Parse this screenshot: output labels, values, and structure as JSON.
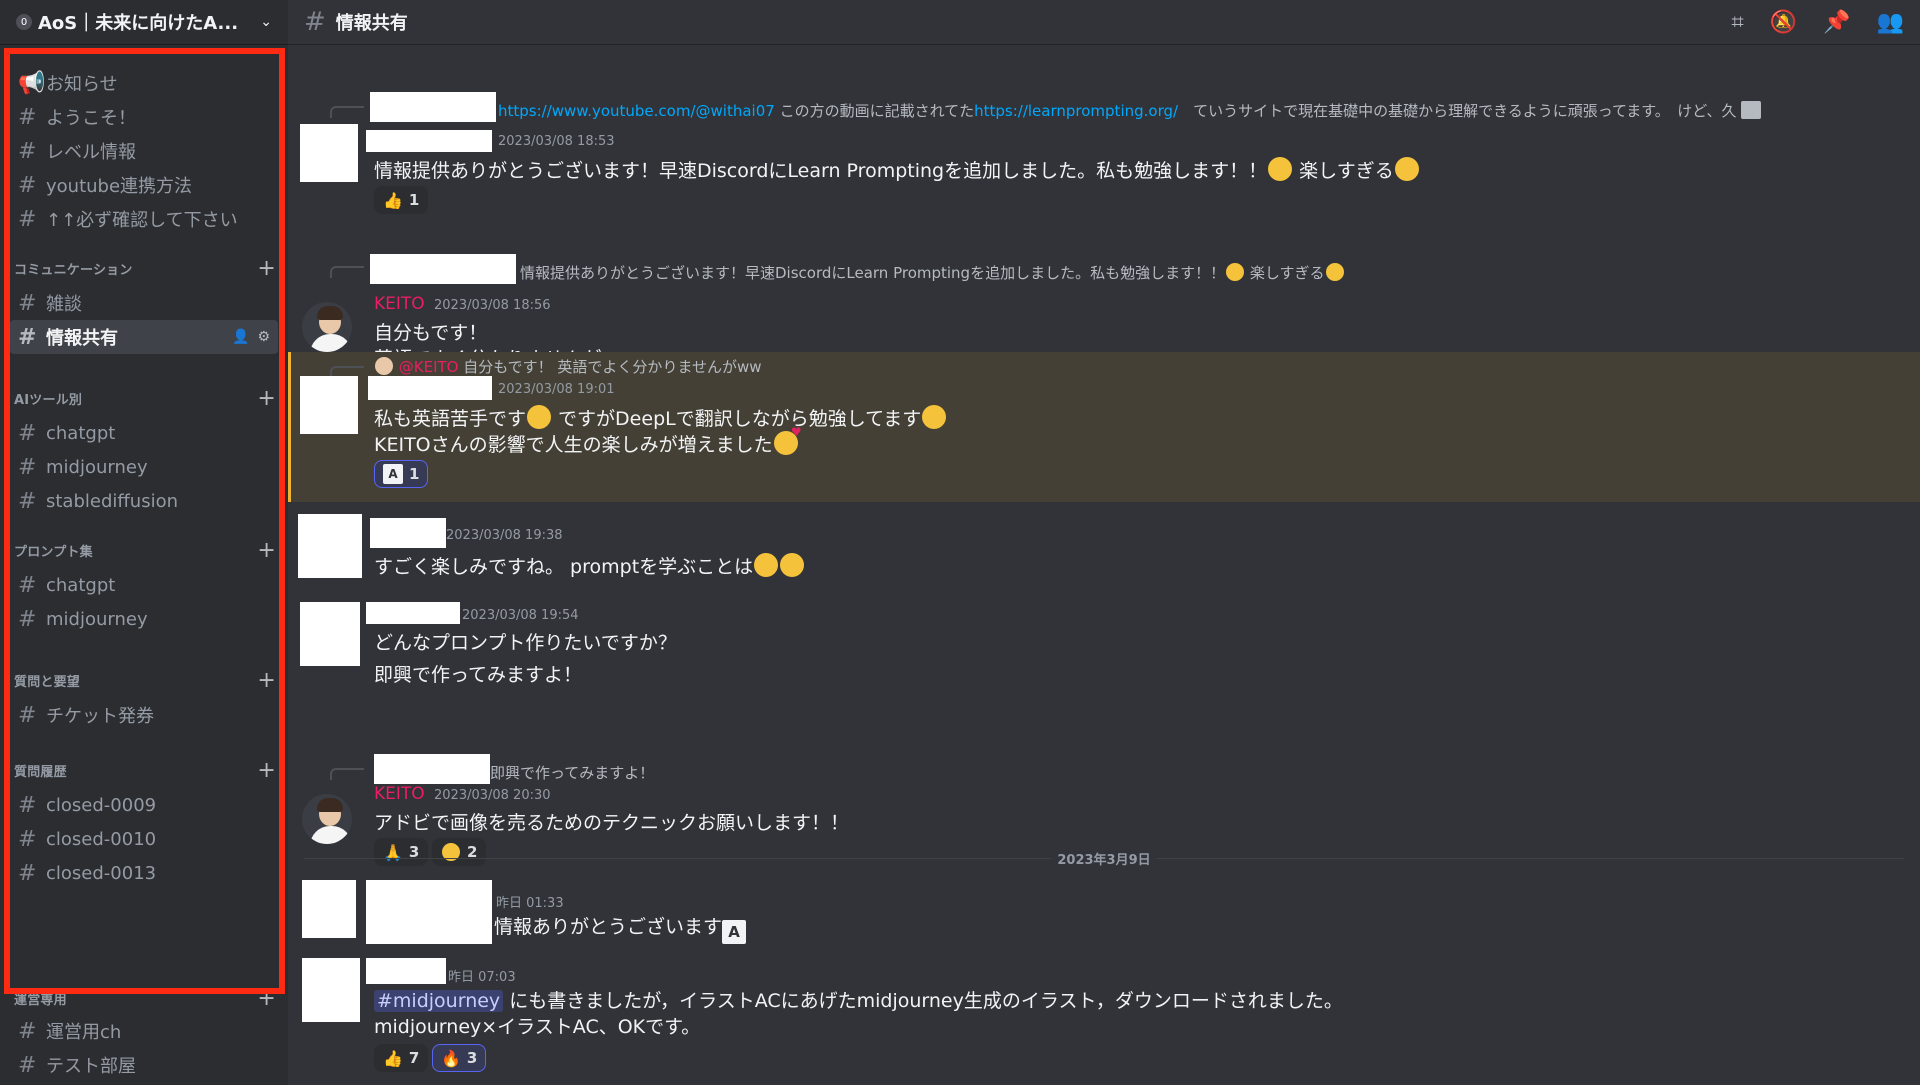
{
  "server": {
    "badge": "0",
    "name": "AoS｜未来に向けたA..."
  },
  "sidebar": {
    "channels_top": [
      {
        "label": "お知らせ",
        "icon": "megaphone-icon"
      },
      {
        "label": "ようこそ！",
        "icon": "hash-icon"
      },
      {
        "label": "レベル情報",
        "icon": "hash-icon"
      },
      {
        "label": "youtube連携方法",
        "icon": "hash-icon"
      },
      {
        "label": "↑↑必ず確認して下さい",
        "icon": "hash-icon"
      }
    ],
    "categories": {
      "communication": "コミュニケーション",
      "ai_tools": "AIツール別",
      "prompts": "プロンプト集",
      "questions": "質問と要望",
      "history": "質問履歴",
      "admin": "運営専用"
    },
    "communication": [
      "雑談",
      "情報共有"
    ],
    "ai_tools": [
      "chatgpt",
      "midjourney",
      "stablediffusion"
    ],
    "prompts": [
      "chatgpt",
      "midjourney"
    ],
    "questions": [
      "チケット発券"
    ],
    "history": [
      "closed-0009",
      "closed-0010",
      "closed-0013"
    ],
    "admin": [
      "運営用ch",
      "テスト部屋"
    ],
    "highlight_color": "#ff2a12"
  },
  "topbar": {
    "channel": "情報共有"
  },
  "messages": {
    "m1": {
      "reply_link1": "https://www.youtube.com/@withai07",
      "reply_mid": " この方の動画に記載されてた",
      "reply_link2": "https://learnprompting.org/",
      "reply_tail": "　ていうサイトで現在基礎中の基礎から理解できるように頑張ってます。　けど、久",
      "time": "2023/03/08 18:53",
      "text": "情報提供ありがとうございます！早速DiscordにLearn Promptingを追加しました。私も勉強します！！",
      "text_tail": " 楽しすぎる",
      "reaction_count": "1"
    },
    "m2": {
      "reply": "情報提供ありがとうございます！早速DiscordにLearn Promptingを追加しました。私も勉強します！！",
      "reply_tail": " 楽しすぎる",
      "author": "KEITO",
      "time": "2023/03/08 18:56",
      "line1": "自分もです！",
      "line2": "英語でよく分かりませんがww"
    },
    "m3": {
      "reply_author": "@KEITO",
      "reply": " 自分もです！ 英語でよく分かりませんがww",
      "time": "2023/03/08 19:01",
      "line1a": "私も英語苦手です",
      "line1b": " ですがDeepLで翻訳しながら勉強してます",
      "line2": "KEITOさんの影響で人生の楽しみが増えました",
      "reaction_icon": "A",
      "reaction_count": "1"
    },
    "m4": {
      "time": "2023/03/08 19:38",
      "text": "すごく楽しみですね。 promptを学ぶことは"
    },
    "m5": {
      "time": "2023/03/08 19:54",
      "line1": "どんなプロンプト作りたいですか？",
      "line2": "即興で作ってみますよ！"
    },
    "m6": {
      "reply": "即興で作ってみますよ！",
      "author": "KEITO",
      "time": "2023/03/08 20:30",
      "text": "アドビで画像を売るためのテクニックお願いします！！",
      "reaction1": "3",
      "reaction2": "2"
    },
    "date_divider": "2023年3月9日",
    "m7": {
      "time": "昨日 01:33",
      "text": "情報ありがとうございます",
      "icon": "A"
    },
    "m8": {
      "time": "昨日 07:03",
      "mention": "#midjourney",
      "line1": " にも書きましたが，イラストACにあげたmidjourney生成のイラスト，ダウンロードされました。",
      "line2": "midjourney×イラストAC、OKです。",
      "reaction1": "7",
      "reaction2": "3"
    }
  }
}
